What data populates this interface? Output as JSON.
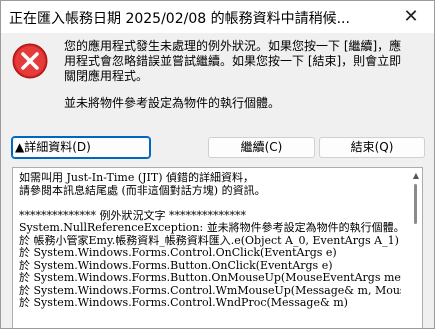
{
  "window": {
    "title": "正在匯入帳務日期 2025/02/08 的帳務資料中請稍候...",
    "close_glyph": "✕"
  },
  "message": {
    "lines": [
      "您的應用程式發生未處理的例外狀況。如果您按一下 [繼續]，應",
      "用程式會忽略錯誤並嘗試繼續。如果您按一下 [結束]，則會立即",
      "關閉應用程式。"
    ],
    "detail_line": "並未將物件參考設定為物件的執行個體。"
  },
  "buttons": {
    "details_label": "▲詳細資料(D)",
    "continue_label": "繼續(C)",
    "quit_label": "結束(Q)"
  },
  "details": {
    "lines": [
      "如需叫用 Just-In-Time (JIT) 偵錯的詳細資料，",
      "請參閱本訊息結尾處 (而非這個對話方塊) 的資訊。",
      "",
      "************** 例外狀況文字 **************",
      "System.NullReferenceException: 並未將物件參考設定為物件的執行個體。",
      "   於 帳務小管家Emy.帳務資料_帳務資料匯入.e(Object A_0, EventArgs A_1)",
      "   於 System.Windows.Forms.Control.OnClick(EventArgs e)",
      "   於 System.Windows.Forms.Button.OnClick(EventArgs e)",
      "   於 System.Windows.Forms.Button.OnMouseUp(MouseEventArgs mevent)",
      "   於 System.Windows.Forms.Control.WmMouseUp(Message& m, MouseButtons bu",
      "   於 System.Windows.Forms.Control.WndProc(Message& m)"
    ]
  },
  "colors": {
    "icon_red": "#d42121",
    "focus_blue": "#0067c0"
  }
}
